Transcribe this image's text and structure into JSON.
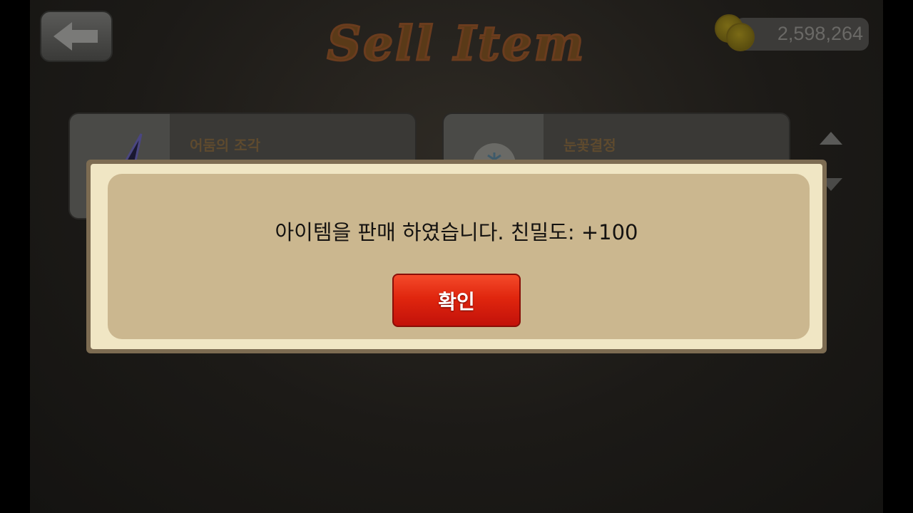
{
  "header": {
    "title": "Sell Item",
    "gold_amount": "2,598,264"
  },
  "items": [
    {
      "name": "어둠의 조각",
      "icon": "dark-shard-icon"
    },
    {
      "name": "눈꽃결정",
      "icon": "snowflake-crystal-icon"
    }
  ],
  "dialog": {
    "message": "아이템을 판매 하였습니다. 친밀도: +100",
    "confirm_label": "확인"
  },
  "colors": {
    "dialog_border": "#7d6c52",
    "dialog_fill": "#cbb78f",
    "confirm_button": "#e0260e"
  }
}
